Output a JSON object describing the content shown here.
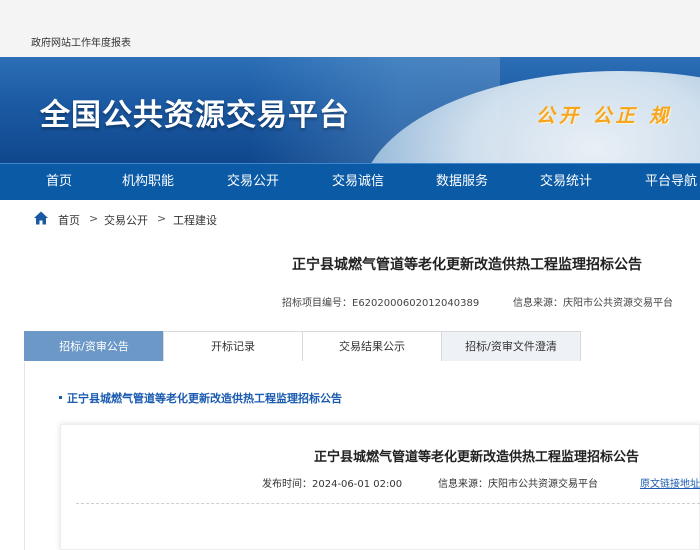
{
  "topbar": {
    "report_link": "政府网站工作年度报表"
  },
  "banner": {
    "title": "全国公共资源交易平台",
    "slogan": "公开 公正 规"
  },
  "nav": {
    "items": [
      "首页",
      "机构职能",
      "交易公开",
      "交易诚信",
      "数据服务",
      "交易统计",
      "平台导航"
    ]
  },
  "breadcrumb": {
    "home": "首页",
    "level1": "交易公开",
    "level2": "工程建设",
    "separator": ">"
  },
  "project": {
    "title": "正宁县城燃气管道等老化更新改造供热工程监理招标公告",
    "code_label": "招标项目编号：E6202000602012040389",
    "source_label": "信息来源：庆阳市公共资源交易平台"
  },
  "tabs": [
    "招标/资审公告",
    "开标记录",
    "交易结果公示",
    "招标/资审文件澄清"
  ],
  "document": {
    "link_text": "正宁县城燃气管道等老化更新改造供热工程监理招标公告",
    "title": "正宁县城燃气管道等老化更新改造供热工程监理招标公告",
    "publish_time": "发布时间：2024-06-01 02:00",
    "source": "信息来源：庆阳市公共资源交易平台",
    "original_link": "原文链接地址"
  },
  "colors": {
    "nav_bg": "#0a5aa6",
    "active_tab": "#6c98c8",
    "link": "#1a5bb0",
    "slogan": "#f7a51c"
  }
}
